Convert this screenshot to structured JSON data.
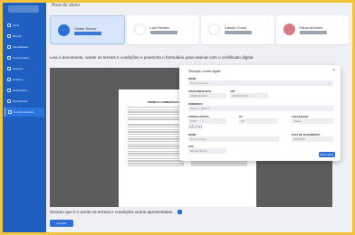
{
  "page": {
    "title": "Área do aluno"
  },
  "sidebar": {
    "items": [
      {
        "label": "Início"
      },
      {
        "label": "Boletim"
      },
      {
        "label": "Mensalidade"
      },
      {
        "label": "Comunicados"
      },
      {
        "label": "Arquivos"
      },
      {
        "label": "Horários"
      },
      {
        "label": "Notificações"
      },
      {
        "label": "Rematrícula"
      },
      {
        "label": "Contrato Escolar"
      }
    ]
  },
  "student_cards": [
    {
      "name": "Gisele Souza",
      "tag": "2º ANO - MÉDIO"
    },
    {
      "name": "Luiz Renato",
      "tag": "4º ANO - FUND."
    },
    {
      "name": "Cássio Costa",
      "tag": "1º ANO - MÉDIO"
    },
    {
      "name": "Paula Antunes",
      "tag": "3º ANO - MÉDIO"
    }
  ],
  "main": {
    "instructions": "Leia o documento, aceite os termos e condições e preencha o formulário para assinar com o certificado digital.",
    "agree_label": "Declaro que li e aceito os termos e condições acima apresentados.",
    "submit_label": "Concluir"
  },
  "pdf": {
    "title": "TERMO E CONDIÇÕES GERAIS DE UTILIZAÇÃO DE SERVIÇO"
  },
  "modal": {
    "title": "Situação contra digital",
    "close_icon": "close-icon",
    "fields": {
      "nome_label": "NOME",
      "nome_value": "Nome da pessoa",
      "telefone_label": "TELEFONE/E-MAIL",
      "telefone_value": "(00)00000-0000",
      "cpf_label": "CPF",
      "cpf_value": "000.000.000-00",
      "endereco_label": "ENDEREÇO",
      "endereco_value": "Rua ex. 2 Rua nº 0",
      "cep_label": "CÓDIGO POSTAL",
      "cep_value": "00000",
      "ufr_label": "UF",
      "ufr_value": "SP",
      "localidade_label": "LOCALIDADE",
      "localidade_value": "Cidade",
      "aluno_section": "Aluno",
      "aluno_nome_label": "NOME",
      "aluno_nome_value": "Nome do aluno",
      "aluno_nasc_label": "DATA DE NASCIMENTO",
      "aluno_nasc_value": "00/00/0000",
      "aluno_cpf_label": "CPF",
      "aluno_cpf_value": "000.000.000-00"
    },
    "save_label": "Salvar dados"
  },
  "colors": {
    "sidebar": "#1f5fc2",
    "accent": "#2d6fd6",
    "outer_border": "#f3c43b"
  }
}
